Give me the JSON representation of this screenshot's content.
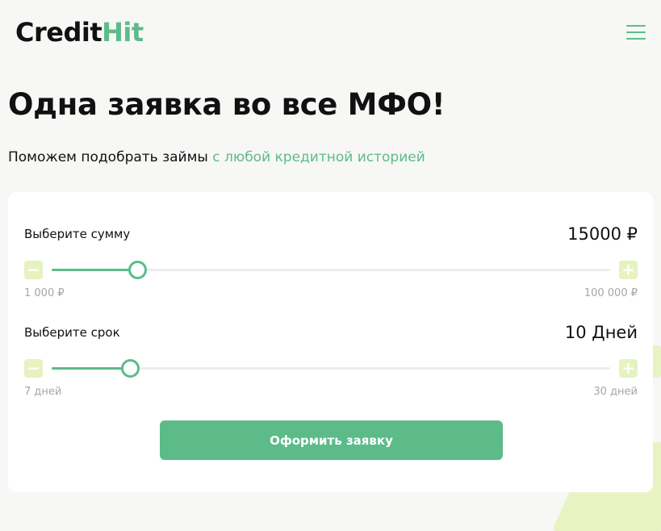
{
  "header": {
    "logo_part1": "Credit",
    "logo_part2": "Hit"
  },
  "hero": {
    "title": "Одна заявка во все МФО!",
    "subtitle_prefix": "Поможем подобрать займы",
    "subtitle_accent": "с любой кредитной историей"
  },
  "calculator": {
    "amount": {
      "label": "Выберите сумму",
      "value": "15000 ₽",
      "min": "1 000 ₽",
      "max": "100 000 ₽",
      "minus": "−",
      "plus": "+",
      "position_percent": 15.5
    },
    "term": {
      "label": "Выберите срок",
      "value": "10 Дней",
      "min": "7 дней",
      "max": "30 дней",
      "minus": "−",
      "plus": "+",
      "position_percent": 14.2
    },
    "submit_label": "Оформить заявку"
  },
  "colors": {
    "accent": "#5dbb8a",
    "lime": "#e6f2c0",
    "background": "#f7f7f5"
  }
}
